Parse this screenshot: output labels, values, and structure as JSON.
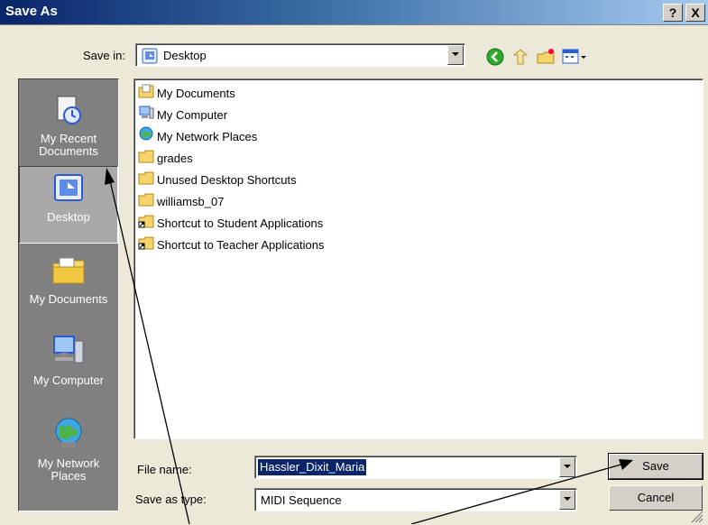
{
  "window": {
    "title": "Save As",
    "help_label": "?",
    "close_label": "X"
  },
  "toolbar": {
    "save_in_label": "Save in:",
    "save_in_value": "Desktop",
    "icons": [
      "back-icon",
      "up-folder-icon",
      "new-folder-icon",
      "view-menu-icon"
    ]
  },
  "places": [
    {
      "label_line1": "My Recent",
      "label_line2": "Documents",
      "icon": "recent-documents-icon"
    },
    {
      "label_line1": "Desktop",
      "label_line2": "",
      "icon": "desktop-icon",
      "selected": true
    },
    {
      "label_line1": "My Documents",
      "label_line2": "",
      "icon": "my-documents-icon"
    },
    {
      "label_line1": "My Computer",
      "label_line2": "",
      "icon": "my-computer-icon"
    },
    {
      "label_line1": "My Network",
      "label_line2": "Places",
      "icon": "network-icon"
    }
  ],
  "files": [
    {
      "name": "My Documents",
      "icon": "my-documents-icon"
    },
    {
      "name": "My Computer",
      "icon": "my-computer-icon"
    },
    {
      "name": "My Network Places",
      "icon": "network-icon"
    },
    {
      "name": "grades",
      "icon": "folder-icon"
    },
    {
      "name": "Unused Desktop Shortcuts",
      "icon": "folder-icon"
    },
    {
      "name": "williamsb_07",
      "icon": "folder-icon"
    },
    {
      "name": "Shortcut to Student Applications",
      "icon": "folder-shortcut-icon"
    },
    {
      "name": "Shortcut to Teacher Applications",
      "icon": "folder-shortcut-icon"
    }
  ],
  "form": {
    "file_name_label": "File name:",
    "file_name_value": "Hassler_Dixit_Maria",
    "save_as_type_label": "Save as type:",
    "save_as_type_value": "MIDI Sequence",
    "save_button": "Save",
    "cancel_button": "Cancel"
  },
  "colors": {
    "dialog_bg": "#ece9d8",
    "titlebar_dark": "#0a246a",
    "places_bg": "#808080",
    "selection": "#0a246a"
  }
}
